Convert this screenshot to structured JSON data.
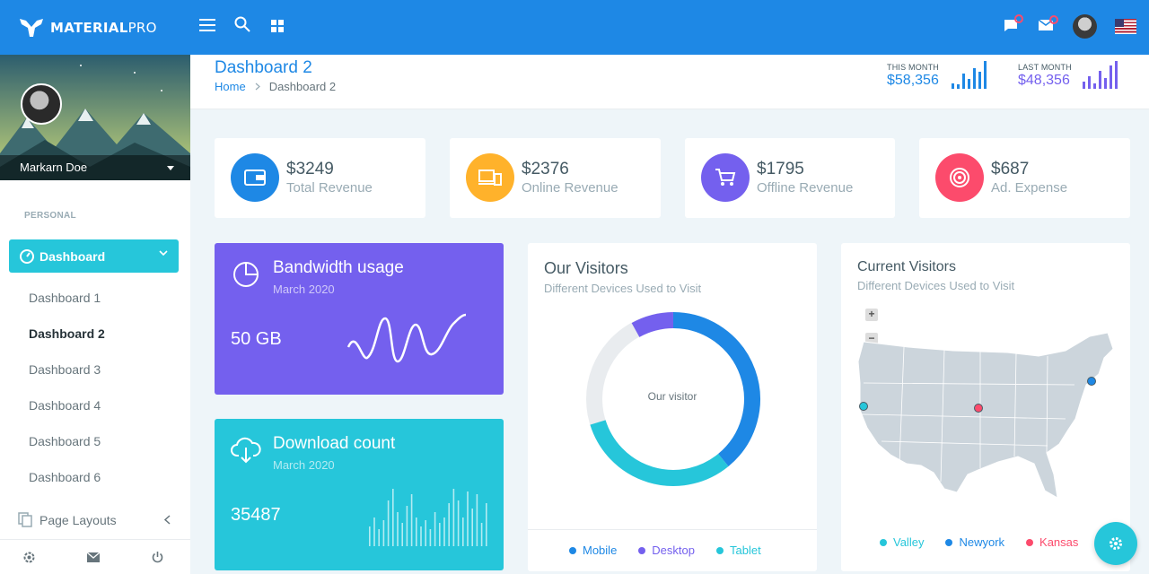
{
  "app": {
    "logo_main": "MATERIAL",
    "logo_thin": "PRO"
  },
  "topbar": {
    "icons": [
      "menu-icon",
      "search-icon",
      "grid-icon",
      "message-icon",
      "mail-icon",
      "user-avatar",
      "flag-us-icon"
    ]
  },
  "sidebar": {
    "user_name": "Markarn Doe",
    "section_caption": "PERSONAL",
    "active_item": "Dashboard",
    "sub_items": [
      "Dashboard 1",
      "Dashboard 2",
      "Dashboard 3",
      "Dashboard 4",
      "Dashboard 5",
      "Dashboard 6"
    ],
    "current_sub": "Dashboard 2",
    "page_layouts": "Page Layouts"
  },
  "header": {
    "title": "Dashboard 2",
    "breadcrumb": [
      "Home",
      "Dashboard 2"
    ],
    "this_month": {
      "label": "THIS MONTH",
      "value": "$58,356",
      "bars": [
        0.2,
        0.15,
        0.55,
        0.35,
        0.75,
        0.6,
        1.0
      ]
    },
    "last_month": {
      "label": "LAST MONTH",
      "value": "$48,356",
      "bars": [
        0.25,
        0.45,
        0.2,
        0.65,
        0.4,
        0.85,
        1.0
      ]
    }
  },
  "kpis": [
    {
      "value": "$3249",
      "label": "Total Revenue",
      "color": "#1e88e5",
      "icon": "wallet-icon"
    },
    {
      "value": "$2376",
      "label": "Online Revenue",
      "color": "#ffb22b",
      "icon": "devices-icon"
    },
    {
      "value": "$1795",
      "label": "Offline Revenue",
      "color": "#7460ee",
      "icon": "cart-icon"
    },
    {
      "value": "$687",
      "label": "Ad. Expense",
      "color": "#fc4b6c",
      "icon": "target-icon"
    }
  ],
  "bandwidth": {
    "title": "Bandwidth usage",
    "subtitle": "March 2020",
    "value": "50 GB",
    "color": "#7460ee"
  },
  "downloads": {
    "title": "Download count",
    "subtitle": "March 2020",
    "value": "35487",
    "color": "#26c6da",
    "bars": [
      0.35,
      0.5,
      0.3,
      0.45,
      0.8,
      1.0,
      0.6,
      0.4,
      0.7,
      0.9,
      0.5,
      0.35,
      0.45,
      0.3,
      0.6,
      0.4,
      0.5,
      0.75,
      1.0,
      0.8,
      0.5,
      0.95,
      0.65,
      0.9,
      0.4,
      0.75
    ]
  },
  "visitors": {
    "title": "Our Visitors",
    "subtitle": "Different Devices Used to Visit",
    "center_label": "Our visitor",
    "legend": [
      {
        "name": "Mobile",
        "color": "#1e88e5"
      },
      {
        "name": "Desktop",
        "color": "#7460ee"
      },
      {
        "name": "Tablet",
        "color": "#26c6da"
      }
    ]
  },
  "current_visitors": {
    "title": "Current Visitors",
    "subtitle": "Different Devices Used to Visit",
    "legend": [
      {
        "name": "Valley",
        "color": "#26c6da"
      },
      {
        "name": "Newyork",
        "color": "#1e88e5"
      },
      {
        "name": "Kansas",
        "color": "#fc4b6c"
      }
    ]
  }
}
